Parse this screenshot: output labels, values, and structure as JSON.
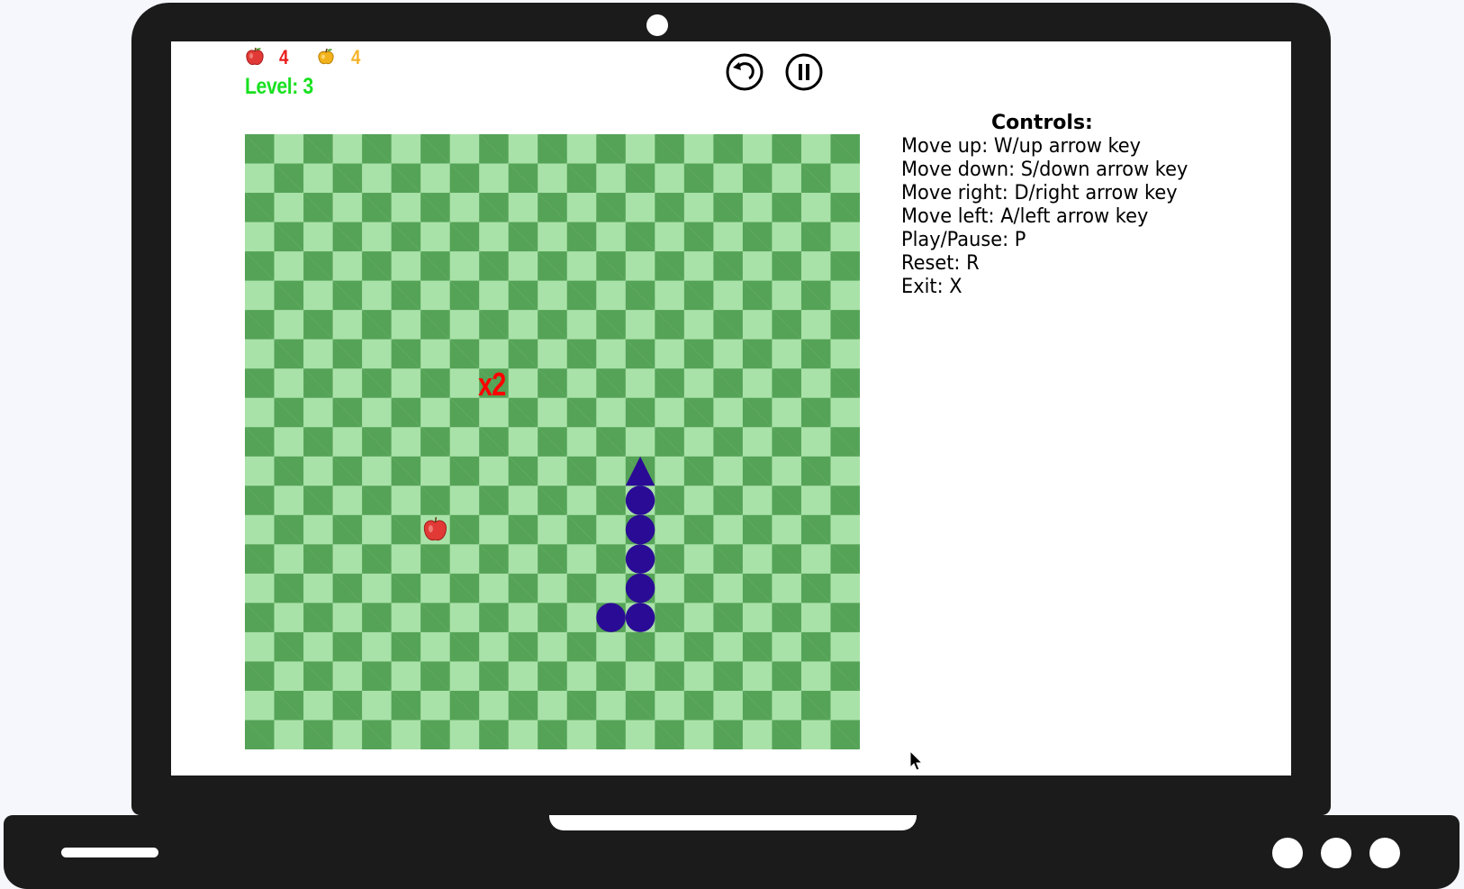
{
  "hud": {
    "apples_icon": "red-apple-icon",
    "apples_count": "4",
    "golden_icon": "golden-apple-icon",
    "golden_count": "4",
    "level_label": "Level: 3"
  },
  "toolbar": {
    "reset_icon": "circular-arrow-icon",
    "pause_icon": "pause-icon"
  },
  "board": {
    "columns": 21,
    "rows": 21,
    "light_color": "#a9e2a9",
    "dark_color": "#55a357",
    "snake_color": "#2a0b95",
    "multiplier_label": "x2",
    "multiplier_color": "#ff0000",
    "apple": {
      "col": 6,
      "row": 13
    },
    "multiplier_cell": {
      "col": 8,
      "row": 8
    },
    "snake": {
      "direction": "up",
      "head": {
        "col": 13,
        "row": 11
      },
      "body": [
        {
          "col": 13,
          "row": 12
        },
        {
          "col": 13,
          "row": 13
        },
        {
          "col": 13,
          "row": 14
        },
        {
          "col": 13,
          "row": 15
        },
        {
          "col": 13,
          "row": 16
        },
        {
          "col": 12,
          "row": 16
        }
      ]
    }
  },
  "controls": {
    "title": "Controls:",
    "items": [
      "Move up: W/up arrow key",
      "Move down: S/down arrow key",
      "Move right: D/right arrow key",
      "Move left: A/left arrow key",
      "Play/Pause: P",
      "Reset: R",
      "Exit: X"
    ]
  }
}
